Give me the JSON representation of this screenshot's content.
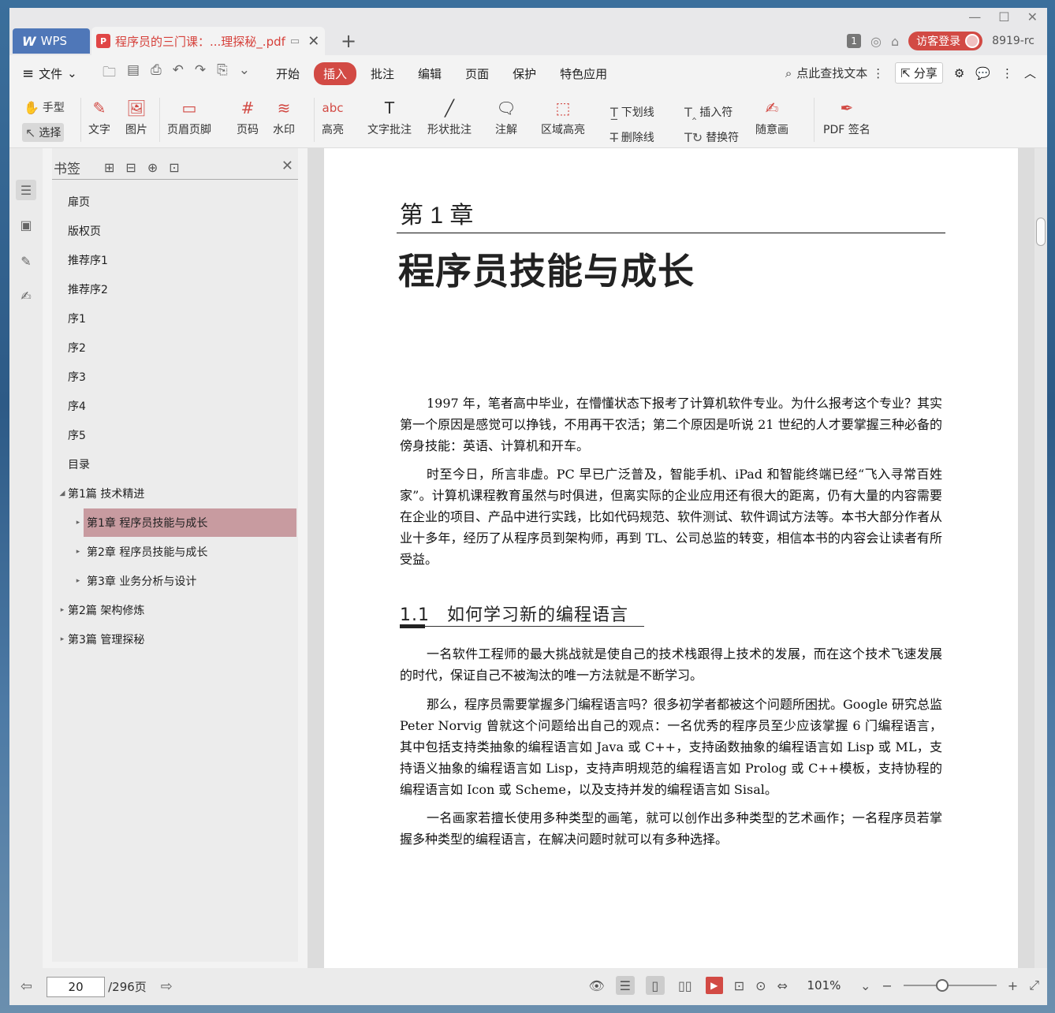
{
  "titlebar": {
    "app_label": "WPS",
    "doc_tab_title": "程序员的三门课：...理探秘_.pdf",
    "page_count_badge": "1",
    "login_label": "访客登录",
    "version_label": "8919-rc"
  },
  "menubar": {
    "file_label": "文件",
    "tabs": [
      "开始",
      "插入",
      "批注",
      "编辑",
      "页面",
      "保护",
      "特色应用"
    ],
    "active_tab": "插入",
    "search_label": "点此查找文本",
    "share_label": "分享"
  },
  "toolbar": {
    "hand": "手型",
    "select": "选择",
    "text": "文字",
    "image": "图片",
    "header_footer": "页眉页脚",
    "page_number": "页码",
    "watermark": "水印",
    "highlight": "高亮",
    "text_comment": "文字批注",
    "shape_comment": "形状批注",
    "note": "注解",
    "area_highlight": "区域高亮",
    "underline": "下划线",
    "strikethrough": "删除线",
    "insert_mark": "插入符",
    "replace_mark": "替换符",
    "freehand": "随意画",
    "pdf_sign": "PDF 签名",
    "highlight_icon_text": "abc"
  },
  "bookmarks": {
    "title": "书签",
    "items": [
      {
        "label": "扉页"
      },
      {
        "label": "版权页"
      },
      {
        "label": "推荐序1"
      },
      {
        "label": "推荐序2"
      },
      {
        "label": "序1"
      },
      {
        "label": "序2"
      },
      {
        "label": "序3"
      },
      {
        "label": "序4"
      },
      {
        "label": "序5"
      },
      {
        "label": "目录"
      },
      {
        "label": "第1篇  技术精进"
      },
      {
        "label": "第1章  程序员技能与成长"
      },
      {
        "label": "第2章  程序员技能与成长"
      },
      {
        "label": "第3章  业务分析与设计"
      },
      {
        "label": "第2篇  架构修炼"
      },
      {
        "label": "第3篇  管理探秘"
      }
    ]
  },
  "page": {
    "chapter_label": "第 1 章",
    "chapter_title": "程序员技能与成长",
    "paragraphs": [
      "1997 年，笔者高中毕业，在懵懂状态下报考了计算机软件专业。为什么报考这个专业？其实第一个原因是感觉可以挣钱，不用再干农活；第二个原因是听说 21 世纪的人才要掌握三种必备的傍身技能：英语、计算机和开车。",
      "时至今日，所言非虚。PC 早已广泛普及，智能手机、iPad 和智能终端已经“飞入寻常百姓家”。计算机课程教育虽然与时俱进，但离实际的企业应用还有很大的距离，仍有大量的内容需要在企业的项目、产品中进行实践，比如代码规范、软件测试、软件调试方法等。本书大部分作者从业十多年，经历了从程序员到架构师，再到 TL、公司总监的转变，相信本书的内容会让读者有所受益。"
    ],
    "section_number": "1.1",
    "section_title": "如何学习新的编程语言",
    "section_paragraphs": [
      "一名软件工程师的最大挑战就是使自己的技术栈跟得上技术的发展，而在这个技术飞速发展的时代，保证自己不被淘汰的唯一方法就是不断学习。",
      "那么，程序员需要掌握多门编程语言吗？很多初学者都被这个问题所困扰。Google 研究总监 Peter Norvig 曾就这个问题给出自己的观点：一名优秀的程序员至少应该掌握 6 门编程语言，其中包括支持类抽象的编程语言如 Java 或 C++，支持函数抽象的编程语言如 Lisp 或 ML，支持语义抽象的编程语言如 Lisp，支持声明规范的编程语言如 Prolog 或 C++模板，支持协程的编程语言如 Icon 或 Scheme，以及支持并发的编程语言如 Sisal。",
      "一名画家若擅长使用多种类型的画笔，就可以创作出多种类型的艺术画作；一名程序员若掌握多种类型的编程语言，在解决问题时就可以有多种选择。"
    ]
  },
  "statusbar": {
    "current_page": "20",
    "total_pages": "/296页",
    "zoom": "101%",
    "zoom_fraction": 0.42
  }
}
